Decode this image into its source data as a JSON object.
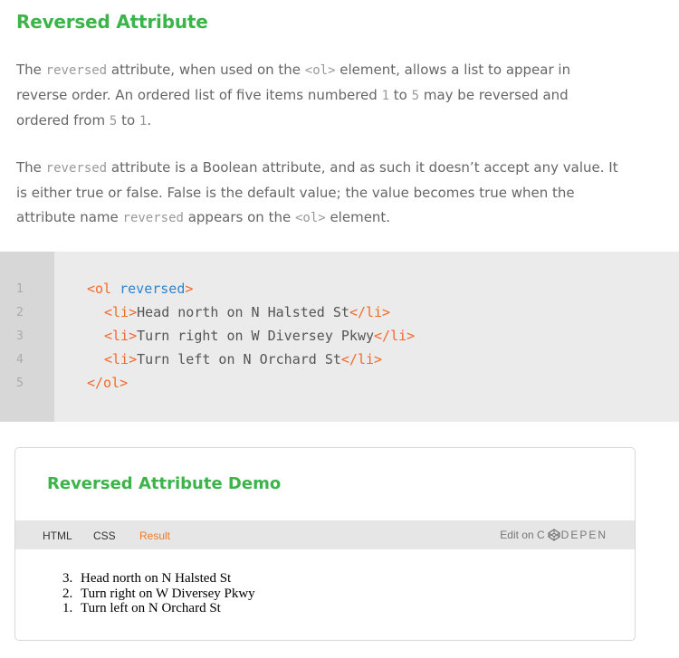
{
  "title": "Reversed Attribute",
  "paragraph1": {
    "a": "The ",
    "code1": "reversed",
    "b": " attribute, when used on the ",
    "code2": "<ol>",
    "c": " element, allows a list to appear in",
    "d": "reverse order. An ordered list of five items numbered ",
    "code3": "1",
    "e": " to ",
    "code4": "5",
    "f": " may be reversed and",
    "g": "ordered from ",
    "code5": "5",
    "h": " to ",
    "code6": "1",
    "i": "."
  },
  "paragraph2": {
    "a": "The ",
    "code1": "reversed",
    "b": " attribute is a Boolean attribute, and as such it doesn’t accept any value. It",
    "c": "is either true or false. False is the default value; the value becomes true when the",
    "d": "attribute name ",
    "code2": "reversed",
    "e": " appears on the ",
    "code3": "<ol>",
    "f": " element."
  },
  "code": {
    "line_numbers": [
      "1",
      "2",
      "3",
      "4",
      "5"
    ],
    "l1_open": "<ol",
    "l1_attr": " reversed",
    "l1_close": ">",
    "l2_open": "<li>",
    "l2_text": "Head north on N Halsted St",
    "l2_close": "</li>",
    "l3_open": "<li>",
    "l3_text": "Turn right on W Diversey Pkwy",
    "l3_close": "</li>",
    "l4_open": "<li>",
    "l4_text": "Turn left on N Orchard St",
    "l4_close": "</li>",
    "l5": "</ol>"
  },
  "demo": {
    "title": "Reversed Attribute Demo",
    "tabs": [
      "HTML",
      "CSS",
      "Result"
    ],
    "active_tab": "Result",
    "edit_on": "Edit on",
    "brand_c": "C",
    "brand_rest": "DEPEN",
    "result_items": [
      {
        "num": "3.",
        "text": "Head north on N Halsted St"
      },
      {
        "num": "2.",
        "text": "Turn right on W Diversey Pkwy"
      },
      {
        "num": "1.",
        "text": "Turn left on N Orchard St"
      }
    ]
  },
  "colors": {
    "accent_green": "#3cb44a",
    "tag_orange": "#f2692a",
    "attr_blue": "#2b84d1",
    "active_tab_orange": "#f47a20"
  }
}
